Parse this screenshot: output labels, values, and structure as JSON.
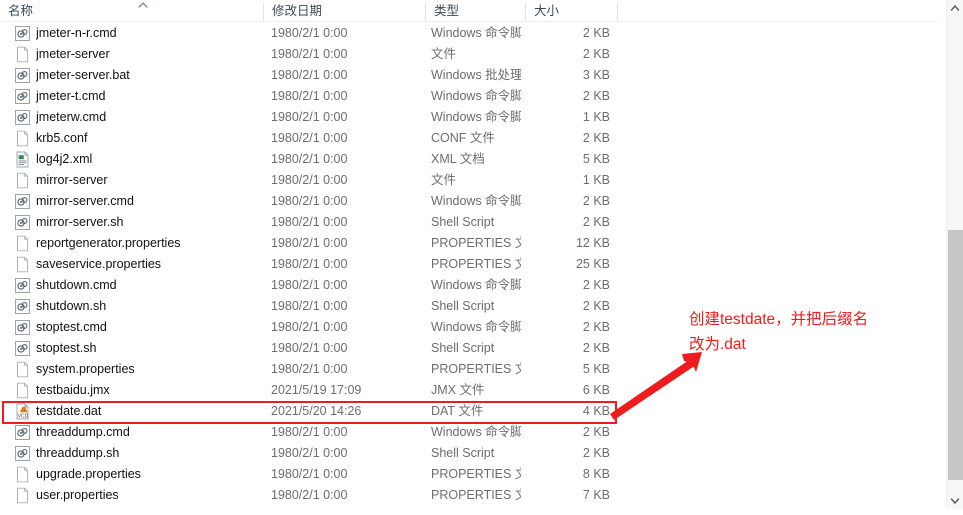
{
  "window": {
    "type": "windows-file-explorer-list"
  },
  "columns": {
    "name": "名称",
    "date_modified": "修改日期",
    "type": "类型",
    "size": "大小",
    "sort_indicator": "⌃",
    "sorted_by": "名称",
    "sort_direction": "ascending"
  },
  "files": [
    {
      "name": "jmeter-n-r.cmd",
      "date": "1980/2/1 0:00",
      "type": "Windows 命令脚本",
      "size": "2 KB",
      "icon": "cmd-script-icon"
    },
    {
      "name": "jmeter-server",
      "date": "1980/2/1 0:00",
      "type": "文件",
      "size": "2 KB",
      "icon": "blank-file-icon"
    },
    {
      "name": "jmeter-server.bat",
      "date": "1980/2/1 0:00",
      "type": "Windows 批处理...",
      "size": "3 KB",
      "icon": "cmd-script-icon"
    },
    {
      "name": "jmeter-t.cmd",
      "date": "1980/2/1 0:00",
      "type": "Windows 命令脚本",
      "size": "2 KB",
      "icon": "cmd-script-icon"
    },
    {
      "name": "jmeterw.cmd",
      "date": "1980/2/1 0:00",
      "type": "Windows 命令脚本",
      "size": "1 KB",
      "icon": "cmd-script-icon"
    },
    {
      "name": "krb5.conf",
      "date": "1980/2/1 0:00",
      "type": "CONF 文件",
      "size": "2 KB",
      "icon": "blank-file-icon"
    },
    {
      "name": "log4j2.xml",
      "date": "1980/2/1 0:00",
      "type": "XML 文档",
      "size": "5 KB",
      "icon": "xml-document-icon"
    },
    {
      "name": "mirror-server",
      "date": "1980/2/1 0:00",
      "type": "文件",
      "size": "1 KB",
      "icon": "blank-file-icon"
    },
    {
      "name": "mirror-server.cmd",
      "date": "1980/2/1 0:00",
      "type": "Windows 命令脚本",
      "size": "2 KB",
      "icon": "cmd-script-icon"
    },
    {
      "name": "mirror-server.sh",
      "date": "1980/2/1 0:00",
      "type": "Shell Script",
      "size": "2 KB",
      "icon": "cmd-script-icon"
    },
    {
      "name": "reportgenerator.properties",
      "date": "1980/2/1 0:00",
      "type": "PROPERTIES 文件",
      "size": "12 KB",
      "icon": "blank-file-icon"
    },
    {
      "name": "saveservice.properties",
      "date": "1980/2/1 0:00",
      "type": "PROPERTIES 文件",
      "size": "25 KB",
      "icon": "blank-file-icon"
    },
    {
      "name": "shutdown.cmd",
      "date": "1980/2/1 0:00",
      "type": "Windows 命令脚本",
      "size": "2 KB",
      "icon": "cmd-script-icon"
    },
    {
      "name": "shutdown.sh",
      "date": "1980/2/1 0:00",
      "type": "Shell Script",
      "size": "2 KB",
      "icon": "cmd-script-icon"
    },
    {
      "name": "stoptest.cmd",
      "date": "1980/2/1 0:00",
      "type": "Windows 命令脚本",
      "size": "2 KB",
      "icon": "cmd-script-icon"
    },
    {
      "name": "stoptest.sh",
      "date": "1980/2/1 0:00",
      "type": "Shell Script",
      "size": "2 KB",
      "icon": "cmd-script-icon"
    },
    {
      "name": "system.properties",
      "date": "1980/2/1 0:00",
      "type": "PROPERTIES 文件",
      "size": "5 KB",
      "icon": "blank-file-icon"
    },
    {
      "name": "testbaidu.jmx",
      "date": "2021/5/19 17:09",
      "type": "JMX 文件",
      "size": "6 KB",
      "icon": "blank-file-icon"
    },
    {
      "name": "testdate.dat",
      "date": "2021/5/20 14:26",
      "type": "DAT 文件",
      "size": "4 KB",
      "icon": "vlc-media-icon"
    },
    {
      "name": "threaddump.cmd",
      "date": "1980/2/1 0:00",
      "type": "Windows 命令脚本",
      "size": "2 KB",
      "icon": "cmd-script-icon"
    },
    {
      "name": "threaddump.sh",
      "date": "1980/2/1 0:00",
      "type": "Shell Script",
      "size": "2 KB",
      "icon": "cmd-script-icon"
    },
    {
      "name": "upgrade.properties",
      "date": "1980/2/1 0:00",
      "type": "PROPERTIES 文件",
      "size": "8 KB",
      "icon": "blank-file-icon"
    },
    {
      "name": "user.properties",
      "date": "1980/2/1 0:00",
      "type": "PROPERTIES 文件",
      "size": "7 KB",
      "icon": "blank-file-icon"
    }
  ],
  "annotation": {
    "text": "创建testdate，并把后缀名\n改为.dat",
    "color": "#ee1c1c",
    "highlighted_row": "testdate.dat"
  },
  "scrollbar": {
    "up_arrow": "⌃",
    "down_arrow": "⌄"
  }
}
